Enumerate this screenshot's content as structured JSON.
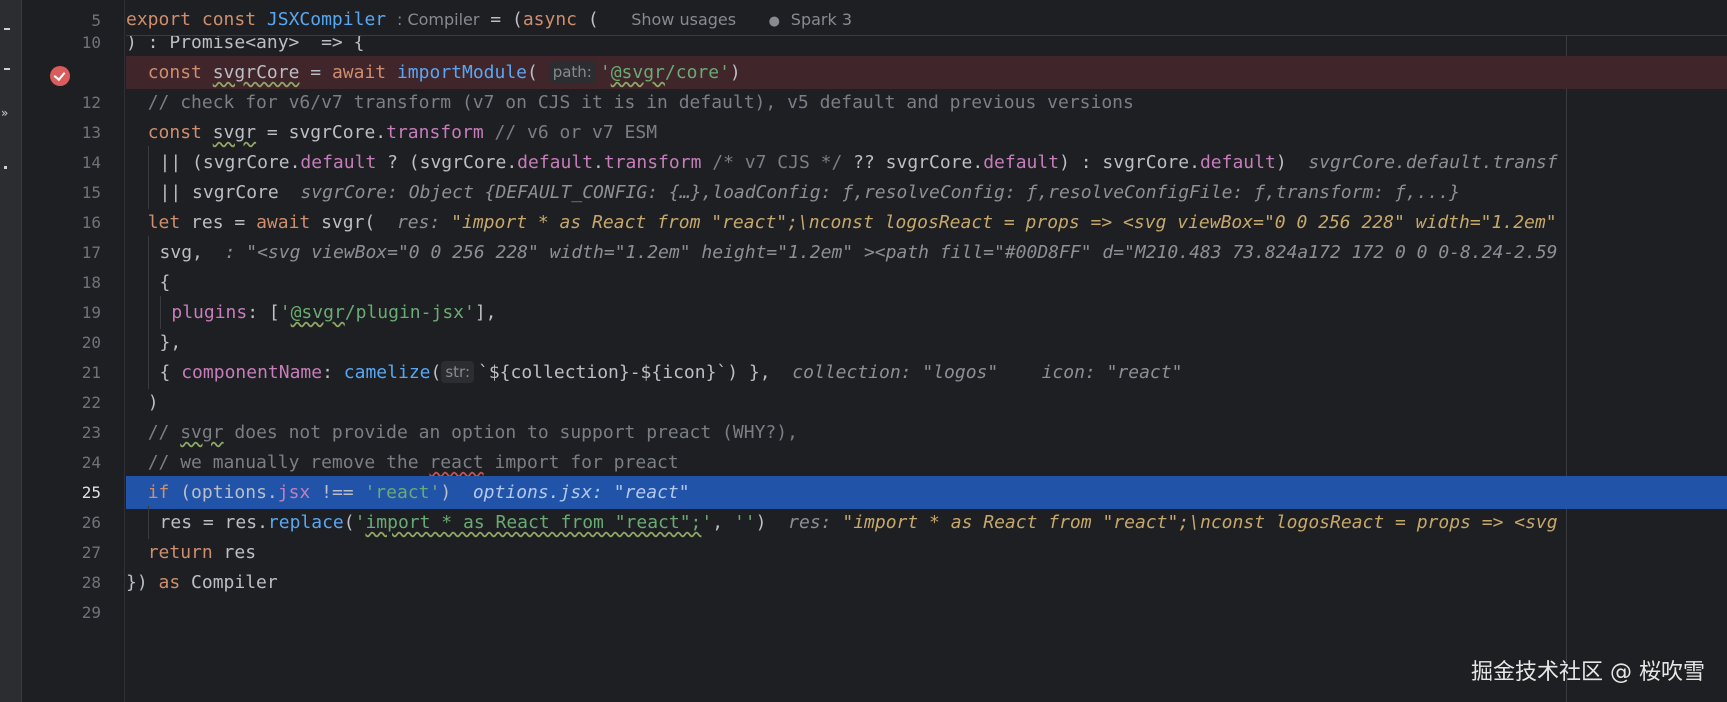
{
  "sticky": {
    "line_number": "5",
    "kw_export": "export",
    "kw_const": "const",
    "name": "JSXCompiler",
    "type_hint": ": Compiler",
    "assign": " = (",
    "kw_async": "async",
    "paren": " (",
    "show_usages": "Show usages",
    "author": "Spark 3"
  },
  "lines": {
    "l10": {
      "n": "10",
      "text": ") : Promise<any>  => {"
    },
    "l11": {
      "n": "11",
      "kw": "const",
      "var": "svgrCore",
      "eq": " = ",
      "await": "await",
      "fn": "importModule",
      "inlay": "path:",
      "str_a": "'",
      "str_b": "@svgr",
      "str_c": "/core'",
      "close": ")"
    },
    "l12": {
      "n": "12",
      "comment": "// check for v6/v7 transform (v7 on CJS it is in default), v5 default and previous versions"
    },
    "l13": {
      "n": "13",
      "kw": "const",
      "var": "svgr",
      "eq": " = svgrCore.",
      "prop": "transform",
      "comment": " // v6 or v7 ESM"
    },
    "l14": {
      "n": "14",
      "a": "|| (svgrCore.",
      "p1": "default",
      "b": " ? (svgrCore.",
      "p2": "default",
      "c": ".",
      "p3": "transform",
      "cm": " /* v7 CJS */",
      "d": " ?? svgrCore.",
      "p4": "default",
      "e": ") : svgrCore.",
      "p5": "default",
      "f": ")",
      "dbg": "svgrCore.default.transf"
    },
    "l15": {
      "n": "15",
      "a": "|| svgrCore",
      "dbg": "svgrCore: Object {DEFAULT_CONFIG: {…},loadConfig: ƒ,resolveConfig: ƒ,resolveConfigFile: ƒ,transform: ƒ,...}"
    },
    "l16": {
      "n": "16",
      "kw": "let",
      "a": " res = ",
      "await": "await",
      "b": " svgr(",
      "dbg_key": "res:",
      "dbg_val": "\"import * as React from \"react\";\\nconst logosReact = props => <svg viewBox=\"0 0 256 228\" width=\"1.2em\""
    },
    "l17": {
      "n": "17",
      "a": "svg,",
      "dbg_val": ": \"<svg viewBox=\"0 0 256 228\" width=\"1.2em\" height=\"1.2em\" ><path fill=\"#00D8FF\" d=\"M210.483 73.824a172 172 0 0 0-8.24-2.59"
    },
    "l18": {
      "n": "18",
      "a": "{"
    },
    "l19": {
      "n": "19",
      "prop": "plugins",
      "a": ": [",
      "s1": "'",
      "s2": "@svgr",
      "s3": "/plugin-jsx'",
      "b": "],"
    },
    "l20": {
      "n": "20",
      "a": "},"
    },
    "l21": {
      "n": "21",
      "a": "{ ",
      "prop": "componentName",
      "b": ": ",
      "fn": "camelize",
      "c": "(",
      "inlay": "str:",
      "d": "`${collection}-${icon}`",
      "e": ") },",
      "dbg1": "collection: \"logos\"",
      "dbg2": "icon: \"react\""
    },
    "l22": {
      "n": "22",
      "a": ")"
    },
    "l23": {
      "n": "23",
      "c1": "// ",
      "c2": "svgr",
      "c3": " does not provide an option to support preact (WHY?),"
    },
    "l24": {
      "n": "24",
      "c1": "// we manually remove the ",
      "c2": "react",
      "c3": " import for preact"
    },
    "l25": {
      "n": "25",
      "kw": "if",
      "a": " (options.",
      "prop": "jsx",
      "b": " !== ",
      "str": "'react'",
      "c": ")",
      "dbg": "options.jsx: \"react\""
    },
    "l26": {
      "n": "26",
      "a": "res = res.",
      "fn": "replace",
      "b": "(",
      "s1": "'",
      "s2": "import * as React from \"react\";",
      "s3": "'",
      "c": ", ",
      "s4": "''",
      "d": ")",
      "dbg_key": "res:",
      "dbg_val": "\"import * as React from \"react\";\\nconst logosReact = props => <svg"
    },
    "l27": {
      "n": "27",
      "kw": "return",
      "a": " res"
    },
    "l28": {
      "n": "28",
      "a": "}) ",
      "kw": "as",
      "b": " Compiler"
    },
    "l29": {
      "n": "29"
    }
  },
  "watermark": "掘金技术社区 @ 桜吹雪",
  "colors": {
    "keyword": "#cf8e6d",
    "function": "#56a8f5",
    "property": "#c77dbb",
    "string": "#6aab73",
    "comment": "#7a7e85",
    "breakpoint_line": "#40252b",
    "execution_line": "#2154a8",
    "breakpoint": "#db5c5c"
  },
  "icons": {
    "breakpoint": "breakpoint-check-icon",
    "author": "person-icon"
  }
}
